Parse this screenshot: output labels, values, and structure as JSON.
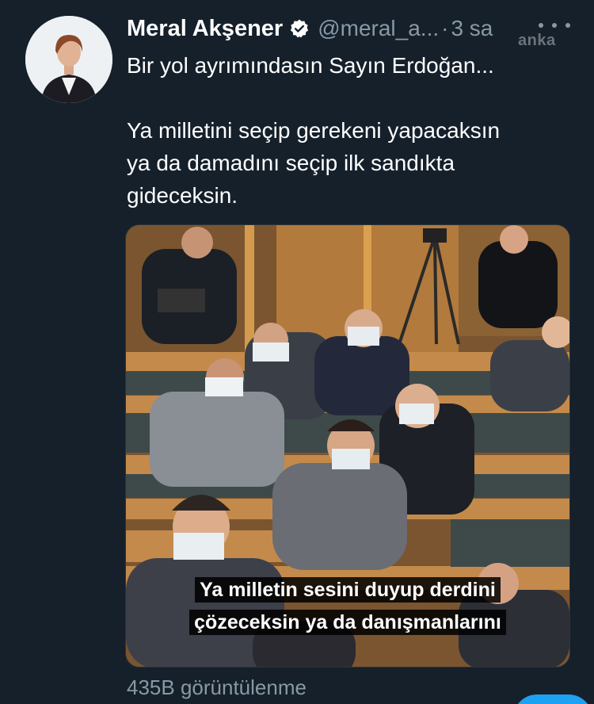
{
  "tweet": {
    "author_name": "Meral Akşener",
    "handle": "@meral_a...",
    "separator": "·",
    "time": "3 sa",
    "text_line1": "Bir yol ayrımındasın Sayın Erdoğan...",
    "text_line2": "Ya milletini seçip gerekeni yapacaksın",
    "text_line3": "ya da damadını seçip ilk sandıkta",
    "text_line4": "gideceksin.",
    "views": "435B görüntülenme"
  },
  "watermark": "anka",
  "video": {
    "caption_line1": "Ya milletin sesini duyup derdini",
    "caption_line2": "çözeceksin ya da danışmanlarını"
  },
  "icons": {
    "verified": "verified-badge-icon",
    "more": "more-options-icon"
  },
  "colors": {
    "background": "#15202b",
    "primary_text": "#ffffff",
    "secondary_text": "#8899a6",
    "accent": "#1da1f2"
  }
}
